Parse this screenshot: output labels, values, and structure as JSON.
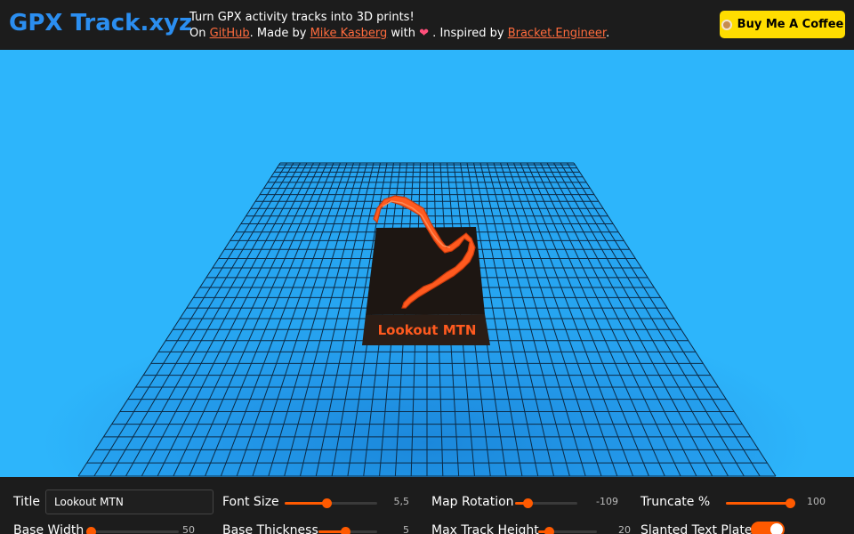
{
  "header": {
    "logo": "GPX Track.xyz",
    "tagline": "Turn GPX activity tracks into 3D prints!",
    "line2": {
      "on": "On ",
      "github": "GitHub",
      "made_by": ". Made by ",
      "author": "Mike Kasberg",
      "with": " with ",
      "heart": "❤",
      "inspired": " . Inspired by ",
      "inspiration": "Bracket.Engineer",
      "end": "."
    },
    "coffee_button": "Buy Me A Coffee"
  },
  "model": {
    "plate_text": "Lookout MTN",
    "track_color": "#ff5a1f",
    "base_color": "#1a1410",
    "grid_color": "#0c2a45"
  },
  "controls": {
    "title": {
      "label": "Title",
      "value": "Lookout MTN"
    },
    "font_size": {
      "label": "Font Size",
      "value": "5,5",
      "fraction": 0.45
    },
    "map_rotation": {
      "label": "Map Rotation",
      "value": "-109",
      "fraction": 0.2
    },
    "truncate": {
      "label": "Truncate %",
      "value": "100",
      "fraction": 1.0
    },
    "base_width": {
      "label": "Base Width",
      "value": "50",
      "fraction": 0.05
    },
    "base_thickness": {
      "label": "Base Thickness",
      "value": "5",
      "fraction": 0.45
    },
    "max_track_height": {
      "label": "Max Track Height",
      "value": "20",
      "fraction": 0.18
    },
    "slanted_text_plate": {
      "label": "Slanted Text Plate",
      "value": true
    }
  }
}
